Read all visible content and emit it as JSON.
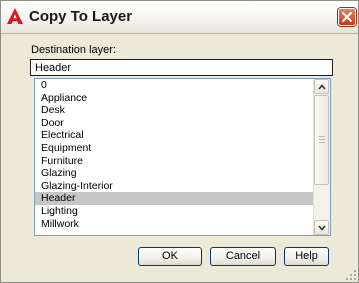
{
  "window": {
    "title": "Copy To Layer",
    "app_icon": "autocad-logo-icon",
    "close_icon": "close-icon"
  },
  "form": {
    "destination_label": "Destination layer:",
    "destination_value": "Header"
  },
  "layers": {
    "items": [
      "0",
      "Appliance",
      "Desk",
      "Door",
      "Electrical",
      "Equipment",
      "Furniture",
      "Glazing",
      "Glazing-Interior",
      "Header",
      "Lighting",
      "Millwork"
    ],
    "selected": "Header"
  },
  "buttons": {
    "ok": "OK",
    "cancel": "Cancel",
    "help": "Help"
  },
  "colors": {
    "dialog_background": "#ece9d8",
    "selection_highlight": "#c6c6c6",
    "close_button": "#c6391a",
    "app_icon": "#d7191d"
  }
}
